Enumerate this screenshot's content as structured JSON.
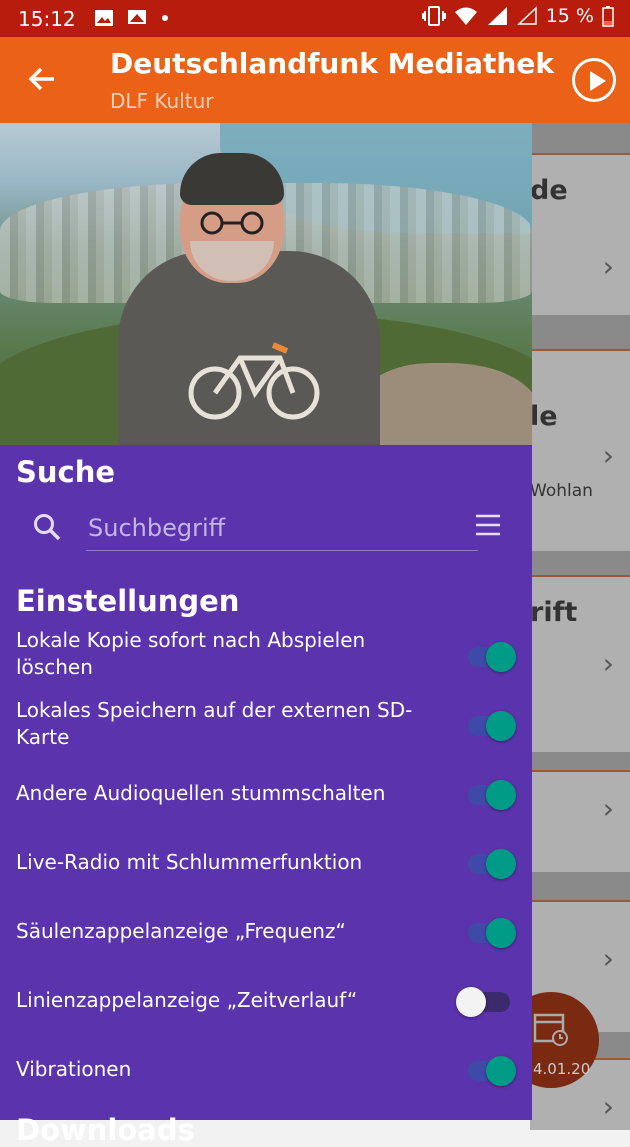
{
  "status_bar": {
    "time": "15:12",
    "battery": "15 %",
    "icons": [
      "image-icon",
      "cast-icon",
      "dot-icon",
      "vibrate-icon",
      "wifi-icon",
      "signal-icon",
      "signal-empty-icon",
      "battery-low-icon"
    ]
  },
  "app_bar": {
    "title": "Deutschlandfunk Mediathek",
    "subtitle": "DLF Kultur",
    "icons": [
      "back-arrow-icon",
      "play-circle-icon"
    ]
  },
  "background_cards": [
    {
      "title": "de",
      "subtitle": ""
    },
    {
      "title": "le",
      "subtitle": "Wohlan"
    },
    {
      "title": "rift",
      "subtitle": ""
    },
    {
      "title": "",
      "subtitle": ""
    },
    {
      "title": "",
      "subtitle": ""
    }
  ],
  "fab": {
    "label": "4.01.20"
  },
  "drawer": {
    "search_heading": "Suche",
    "search_placeholder": "Suchbegriff",
    "settings_heading": "Einstellungen",
    "settings": [
      {
        "label": "Lokale Kopie sofort nach Abspielen löschen",
        "on": true
      },
      {
        "label": "Lokales Speichern auf der externen SD-Karte",
        "on": true
      },
      {
        "label": "Andere Audioquellen stummschalten",
        "on": true
      },
      {
        "label": "Live-Radio mit Schlummerfunktion",
        "on": true
      },
      {
        "label": "Säulenzappelanzeige „Frequenz“",
        "on": true
      },
      {
        "label": "Linienzappelanzeige „Zeitverlauf“",
        "on": false
      },
      {
        "label": "Vibrationen",
        "on": true
      }
    ],
    "downloads_heading": "Downloads"
  },
  "colors": {
    "status_bar": "#b71c0c",
    "app_bar": "#ec6118",
    "drawer": "#5b34ad",
    "switch_on": "#009b86"
  }
}
